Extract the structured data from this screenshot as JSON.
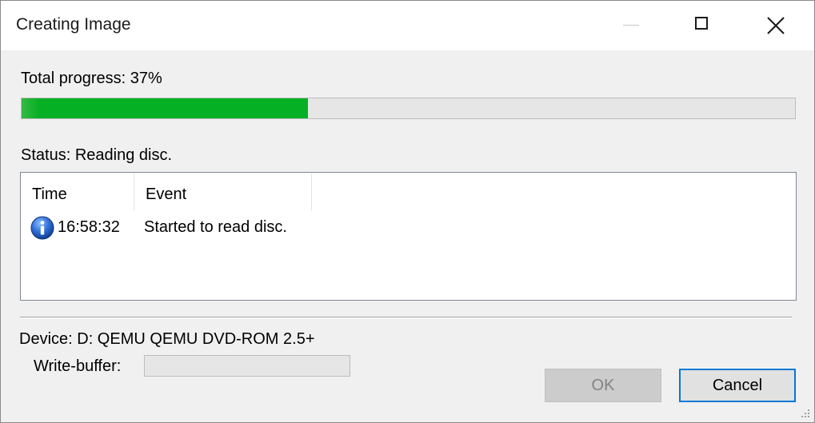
{
  "window": {
    "title": "Creating Image",
    "controls": {
      "minimize_icon": "minimize-icon",
      "maximize_icon": "maximize-icon",
      "close_icon": "close-icon"
    }
  },
  "progress": {
    "label": "Total progress: 37%",
    "value_percent": 37,
    "fill_color": "#06b025"
  },
  "status": {
    "label": "Status: Reading disc."
  },
  "log": {
    "columns": [
      "Time",
      "Event"
    ],
    "rows": [
      {
        "icon": "info-icon",
        "time": "16:58:32",
        "event": "Started to read disc."
      }
    ]
  },
  "device": {
    "label": "Device: D: QEMU QEMU DVD-ROM 2.5+"
  },
  "write_buffer": {
    "label": "Write-buffer:",
    "value_percent": 0
  },
  "buttons": {
    "ok": "OK",
    "cancel": "Cancel"
  },
  "colors": {
    "accent": "#0078d7",
    "progress": "#06b025",
    "info_icon": "#1e5fc8"
  }
}
